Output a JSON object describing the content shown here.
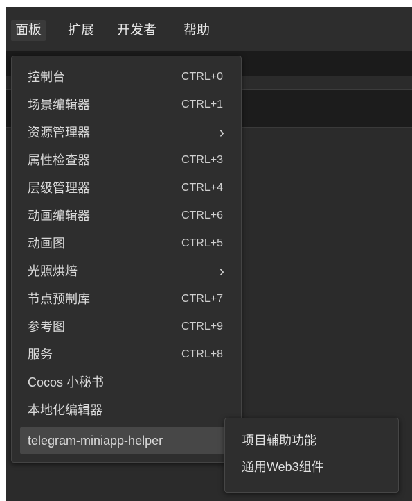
{
  "menubar": {
    "items": [
      {
        "label": "面板",
        "active": true
      },
      {
        "label": "扩展"
      },
      {
        "label": "开发者"
      },
      {
        "label": "帮助"
      }
    ]
  },
  "panel_menu": {
    "items": [
      {
        "label": "控制台",
        "shortcut": "CTRL+0"
      },
      {
        "label": "场景编辑器",
        "shortcut": "CTRL+1"
      },
      {
        "label": "资源管理器",
        "submenu": true,
        "chevron": "›"
      },
      {
        "label": "属性检查器",
        "shortcut": "CTRL+3"
      },
      {
        "label": "层级管理器",
        "shortcut": "CTRL+4"
      },
      {
        "label": "动画编辑器",
        "shortcut": "CTRL+6"
      },
      {
        "label": "动画图",
        "shortcut": "CTRL+5"
      },
      {
        "label": "光照烘焙",
        "submenu": true,
        "chevron": "›"
      },
      {
        "label": "节点预制库",
        "shortcut": "CTRL+7"
      },
      {
        "label": "参考图",
        "shortcut": "CTRL+9"
      },
      {
        "label": "服务",
        "shortcut": "CTRL+8"
      },
      {
        "label": "Cocos 小秘书"
      },
      {
        "label": "本地化编辑器"
      },
      {
        "label": "telegram-miniapp-helper",
        "submenu": true,
        "chevron": "›",
        "highlighted": true
      }
    ]
  },
  "submenu": {
    "items": [
      {
        "label": "项目辅助功能"
      },
      {
        "label": "通用Web3组件"
      }
    ]
  },
  "colors": {
    "menubar_bg": "#2d2d2d",
    "menu_bg": "#2e2e2e",
    "highlight_bg": "#474747",
    "text": "#d9d9d9"
  }
}
